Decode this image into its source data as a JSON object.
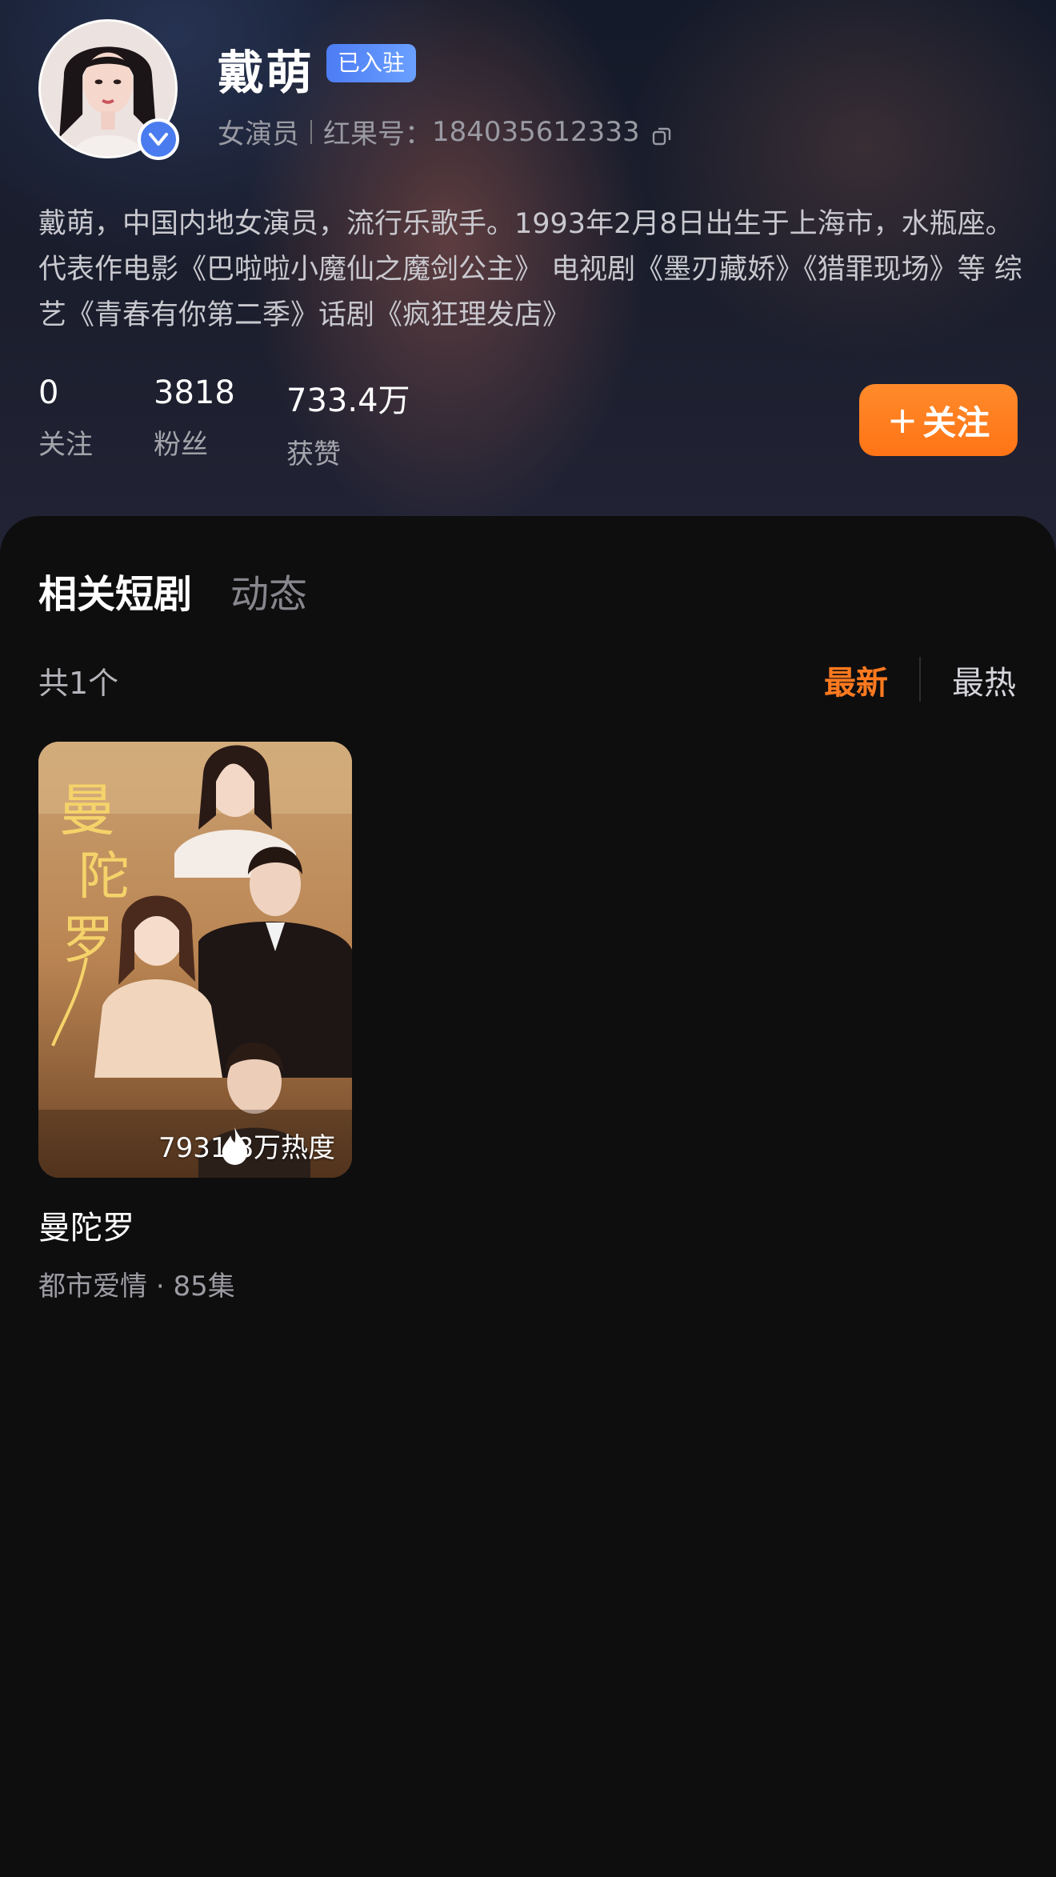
{
  "profile": {
    "name": "戴萌",
    "joined_badge": "已入驻",
    "role": "女演员",
    "id_label": "红果号：",
    "id_value": "184035612333",
    "bio": "戴萌，中国内地女演员，流行乐歌手。1993年2月8日出生于上海市，水瓶座。代表作电影《巴啦啦小魔仙之魔剑公主》 电视剧《墨刃藏娇》《猎罪现场》等 综艺《青春有你第二季》话剧《疯狂理发店》"
  },
  "stats": [
    {
      "value": "0",
      "label": "关注"
    },
    {
      "value": "3818",
      "label": "粉丝"
    },
    {
      "value": "733.4万",
      "label": "获赞"
    }
  ],
  "follow_button": {
    "label": "关注"
  },
  "tabs": [
    {
      "label": "相关短剧",
      "active": true
    },
    {
      "label": "动态",
      "active": false
    }
  ],
  "list": {
    "count": "共1个",
    "sort": {
      "latest": "最新",
      "hot": "最热",
      "selected": "最新"
    }
  },
  "dramas": [
    {
      "title": "曼陀罗",
      "genre": "都市爱情",
      "episodes": "85集",
      "heat": "7931.8万热度",
      "poster_title": "曼陀罗"
    }
  ],
  "colors": {
    "accent": "#ff7a1f",
    "badge": "#4d7cf4",
    "background": "#0e0e0f"
  }
}
